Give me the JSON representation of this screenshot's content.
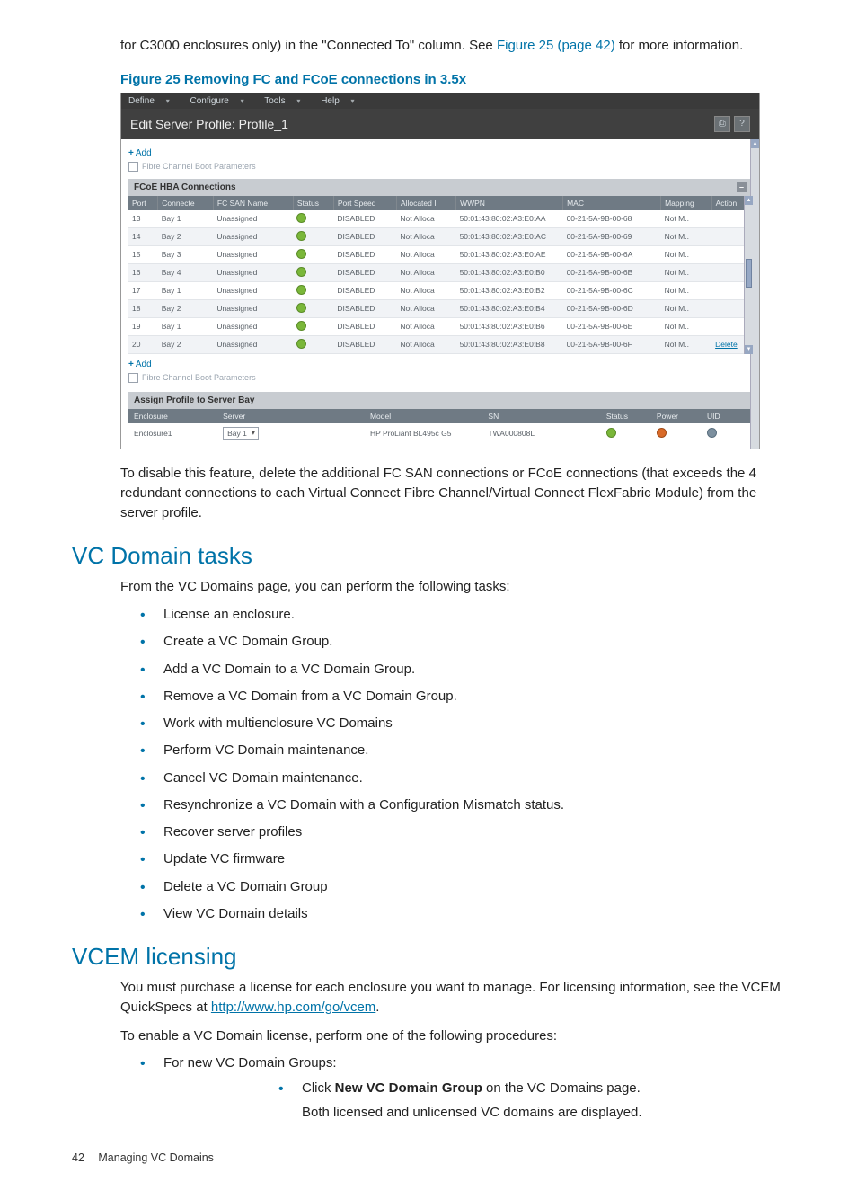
{
  "intro": {
    "text_before_link": "for C3000 enclosures only) in the \"Connected To\" column. See ",
    "figure_link": "Figure 25 (page 42)",
    "text_after_link": " for more information."
  },
  "figure_caption": "Figure 25 Removing FC and FCoE connections in 3.5x",
  "screenshot": {
    "menu": [
      "Define",
      "Configure",
      "Tools",
      "Help"
    ],
    "title": "Edit Server Profile:  Profile_1",
    "add_label": "Add",
    "fibre_param_label": "Fibre Channel Boot Parameters",
    "fcoe_header": "FCoE HBA Connections",
    "columns": [
      "Port",
      "Connecte",
      "FC SAN Name",
      "Status",
      "Port Speed",
      "Allocated I",
      "WWPN",
      "MAC",
      "Mapping",
      "Action"
    ],
    "rows": [
      {
        "port": "13",
        "bay": "Bay 1",
        "san": "Unassigned",
        "speed": "DISABLED",
        "alloc": "Not Alloca",
        "wwpn": "50:01:43:80:02:A3:E0:AA",
        "mac": "00-21-5A-9B-00-68",
        "map": "Not M..",
        "act": ""
      },
      {
        "port": "14",
        "bay": "Bay 2",
        "san": "Unassigned",
        "speed": "DISABLED",
        "alloc": "Not Alloca",
        "wwpn": "50:01:43:80:02:A3:E0:AC",
        "mac": "00-21-5A-9B-00-69",
        "map": "Not M..",
        "act": ""
      },
      {
        "port": "15",
        "bay": "Bay 3",
        "san": "Unassigned",
        "speed": "DISABLED",
        "alloc": "Not Alloca",
        "wwpn": "50:01:43:80:02:A3:E0:AE",
        "mac": "00-21-5A-9B-00-6A",
        "map": "Not M..",
        "act": ""
      },
      {
        "port": "16",
        "bay": "Bay 4",
        "san": "Unassigned",
        "speed": "DISABLED",
        "alloc": "Not Alloca",
        "wwpn": "50:01:43:80:02:A3:E0:B0",
        "mac": "00-21-5A-9B-00-6B",
        "map": "Not M..",
        "act": ""
      },
      {
        "port": "17",
        "bay": "Bay 1",
        "san": "Unassigned",
        "speed": "DISABLED",
        "alloc": "Not Alloca",
        "wwpn": "50:01:43:80:02:A3:E0:B2",
        "mac": "00-21-5A-9B-00-6C",
        "map": "Not M..",
        "act": ""
      },
      {
        "port": "18",
        "bay": "Bay 2",
        "san": "Unassigned",
        "speed": "DISABLED",
        "alloc": "Not Alloca",
        "wwpn": "50:01:43:80:02:A3:E0:B4",
        "mac": "00-21-5A-9B-00-6D",
        "map": "Not M..",
        "act": ""
      },
      {
        "port": "19",
        "bay": "Bay 1",
        "san": "Unassigned",
        "speed": "DISABLED",
        "alloc": "Not Alloca",
        "wwpn": "50:01:43:80:02:A3:E0:B6",
        "mac": "00-21-5A-9B-00-6E",
        "map": "Not M..",
        "act": ""
      },
      {
        "port": "20",
        "bay": "Bay 2",
        "san": "Unassigned",
        "speed": "DISABLED",
        "alloc": "Not Alloca",
        "wwpn": "50:01:43:80:02:A3:E0:B8",
        "mac": "00-21-5A-9B-00-6F",
        "map": "Not M..",
        "act": "Delete"
      }
    ],
    "assign_header": "Assign Profile to Server Bay",
    "assign_cols": [
      "Enclosure",
      "Server",
      "Model",
      "SN",
      "Status",
      "Power",
      "UID"
    ],
    "assign_row": {
      "enclosure": "Enclosure1",
      "server": "Bay 1",
      "model": "HP ProLiant BL495c G5",
      "sn": "TWA000808L"
    }
  },
  "after_figure": "To disable this feature, delete the additional FC SAN connections or FCoE connections (that exceeds the 4 redundant connections to each Virtual Connect Fibre Channel/Virtual Connect FlexFabric Module) from the server profile.",
  "sections": {
    "vc_tasks": {
      "heading": "VC Domain tasks",
      "intro": "From the VC Domains page, you can perform the following tasks:",
      "items": [
        "License an enclosure.",
        "Create a VC Domain Group.",
        "Add a VC Domain to a VC Domain Group.",
        "Remove a VC Domain from a VC Domain Group.",
        "Work with multienclosure VC Domains",
        "Perform VC Domain maintenance.",
        "Cancel VC Domain maintenance.",
        "Resynchronize a VC Domain with a Configuration Mismatch status.",
        "Recover server profiles",
        "Update VC firmware",
        "Delete a VC Domain Group",
        "View VC Domain details"
      ]
    },
    "licensing": {
      "heading": "VCEM licensing",
      "p1_before": "You must purchase a license for each enclosure you want to manage. For licensing information, see the VCEM QuickSpecs at ",
      "url": "http://www.hp.com/go/vcem",
      "p1_after": ".",
      "p2": "To enable a VC Domain license, perform one of the following procedures:",
      "bullet": "For new VC Domain Groups:",
      "step1_a": "Click ",
      "step1_b": "New VC Domain Group",
      "step1_c": " on the VC Domains page.",
      "step1_sub": "Both licensed and unlicensed VC domains are displayed."
    }
  },
  "footer": {
    "page": "42",
    "title": "Managing VC Domains"
  }
}
